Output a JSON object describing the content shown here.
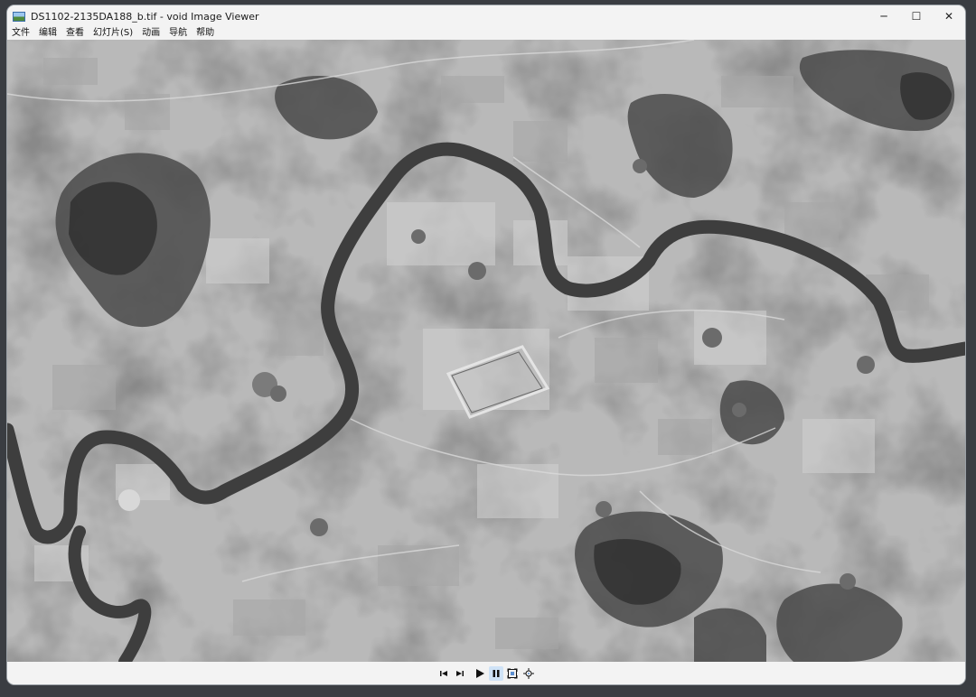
{
  "window": {
    "title": "DS1102-2135DA188_b.tif - void Image Viewer",
    "controls": {
      "minimize": "─",
      "maximize": "☐",
      "close": "✕"
    }
  },
  "menu": {
    "items": [
      "文件",
      "编辑",
      "查看",
      "幻灯片(S)",
      "动画",
      "导航",
      "帮助"
    ]
  },
  "image": {
    "description_icon": "satellite-image",
    "filename": "DS1102-2135DA188_b.tif"
  },
  "playback": {
    "first_icon": "first-frame-icon",
    "last_icon": "last-frame-icon",
    "play_icon": "play-icon",
    "pause_icon": "pause-icon",
    "pause_active": true,
    "fit_icon": "fit-window-icon",
    "center_icon": "center-icon"
  },
  "colors": {
    "window_bg": "#f3f3f3",
    "desktop_bg": "#3a3d42",
    "active_button": "#cfe3f7"
  }
}
